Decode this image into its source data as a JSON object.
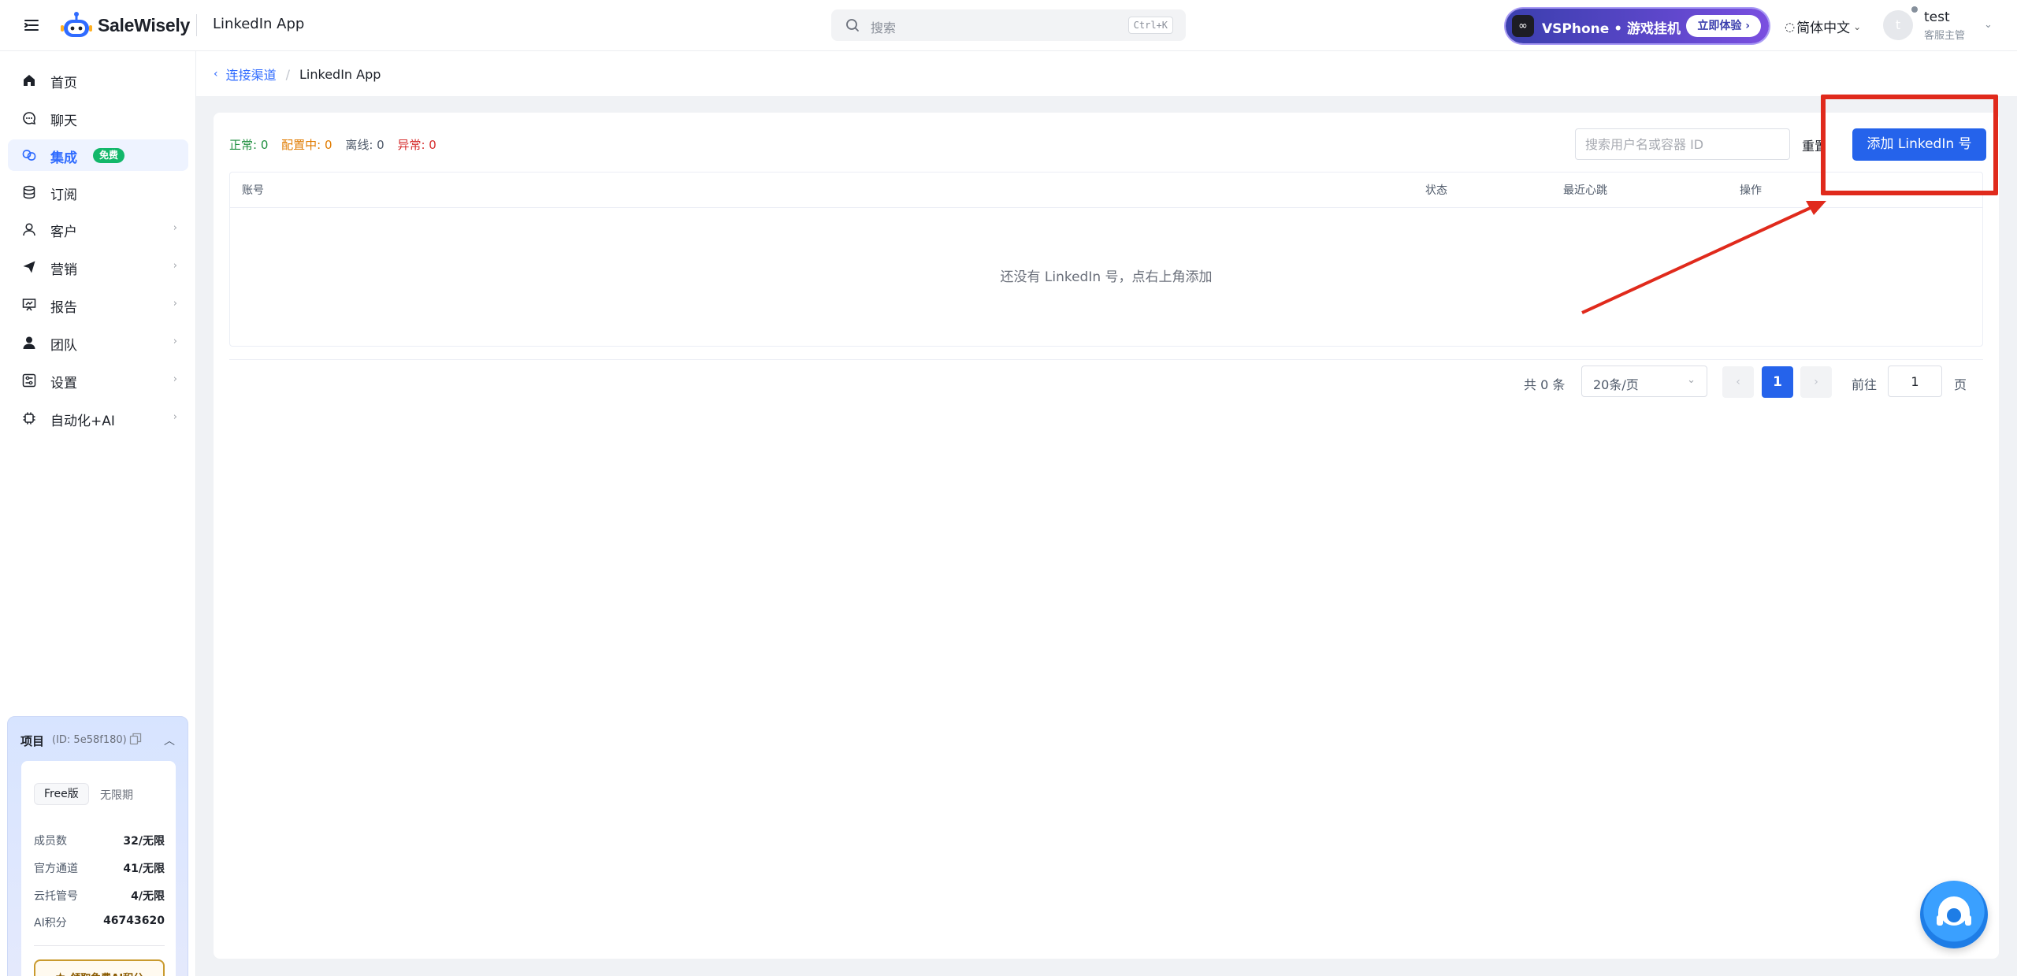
{
  "header": {
    "brand": "SaleWisely",
    "app_title": "LinkedIn App",
    "search": {
      "placeholder": "搜索",
      "shortcut": "Ctrl+K"
    },
    "promo": {
      "text": "VSPhone • 游戏挂机",
      "cta": "立即体验 ›"
    },
    "language": "简体中文",
    "user": {
      "name": "test",
      "role": "客服主管",
      "avatar_initial": "t"
    }
  },
  "sidebar": {
    "items": [
      {
        "label": "首页",
        "icon": "home-icon"
      },
      {
        "label": "聊天",
        "icon": "chat-icon"
      },
      {
        "label": "集成",
        "icon": "integration-icon",
        "badge": "免费",
        "active": true
      },
      {
        "label": "订阅",
        "icon": "database-icon"
      },
      {
        "label": "客户",
        "icon": "user-icon",
        "has_children": true
      },
      {
        "label": "营销",
        "icon": "send-icon",
        "has_children": true
      },
      {
        "label": "报告",
        "icon": "report-icon",
        "has_children": true
      },
      {
        "label": "团队",
        "icon": "team-icon",
        "has_children": true
      },
      {
        "label": "设置",
        "icon": "settings-icon",
        "has_children": true
      },
      {
        "label": "自动化+AI",
        "icon": "chip-icon",
        "has_children": true
      }
    ],
    "project": {
      "title": "项目",
      "id_text": "(ID: 5e58f180)",
      "plan": "Free版",
      "period": "无限期",
      "stats": [
        {
          "k": "成员数",
          "v": "32/无限"
        },
        {
          "k": "官方通道",
          "v": "41/无限"
        },
        {
          "k": "云托管号",
          "v": "4/无限"
        },
        {
          "k": "AI积分",
          "v": "46743620"
        }
      ],
      "claim_label": "领取免费AI积分"
    }
  },
  "breadcrumb": {
    "parent": "连接渠道",
    "sep": "/",
    "current": "LinkedIn App"
  },
  "status_summary": {
    "normal": "正常: 0",
    "config": "配置中: 0",
    "offline": "离线: 0",
    "error": "异常: 0"
  },
  "toolbar": {
    "filter_placeholder": "搜索用户名或容器 ID",
    "reset_label": "重置",
    "add_label": "添加 LinkedIn 号"
  },
  "table": {
    "columns": [
      "账号",
      "状态",
      "最近心跳",
      "操作"
    ],
    "empty_text": "还没有 LinkedIn 号，点右上角添加"
  },
  "pagination": {
    "total": "共 0 条",
    "page_size": "20条/页",
    "current_page": "1",
    "goto_label": "前往",
    "goto_value": "1",
    "page_suffix": "页"
  },
  "colors": {
    "accent": "#2563eb",
    "annotation": "#e02a1c",
    "success": "#12b76a"
  }
}
